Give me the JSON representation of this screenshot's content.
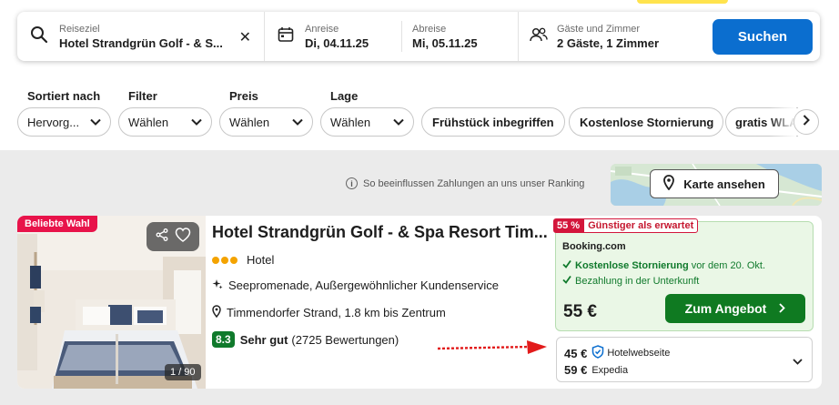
{
  "search": {
    "destination_label": "Reiseziel",
    "destination_value": "Hotel Strandgrün Golf - & S...",
    "checkin_label": "Anreise",
    "checkin_value": "Di, 04.11.25",
    "checkout_label": "Abreise",
    "checkout_value": "Mi, 05.11.25",
    "guests_label": "Gäste und Zimmer",
    "guests_value": "2 Gäste, 1 Zimmer",
    "button_label": "Suchen"
  },
  "filters": {
    "sort": {
      "label": "Sortiert nach",
      "value": "Hervorg..."
    },
    "filter": {
      "label": "Filter",
      "value": "Wählen"
    },
    "price": {
      "label": "Preis",
      "value": "Wählen"
    },
    "location": {
      "label": "Lage",
      "value": "Wählen"
    },
    "chips": [
      "Frühstück inbegriffen",
      "Kostenlose Stornierung",
      "gratis WLAN"
    ]
  },
  "ranking_note": "So beeinflussen Zahlungen an uns unser Ranking",
  "map_button": "Karte ansehen",
  "hotel": {
    "badge": "Beliebte Wahl",
    "photo_count": "1 / 90",
    "name": "Hotel Strandgrün Golf - & Spa Resort Tim...",
    "type": "Hotel",
    "star_count": 3,
    "features": "Seepromenade, Außergewöhnlicher Kundenservice",
    "location": "Timmendorfer Strand, 1.8 km bis Zentrum",
    "rating_score": "8.3",
    "rating_word": "Sehr gut",
    "rating_count": "(2725 Bewertungen)",
    "deal": {
      "discount": "55 %",
      "tag": "Günstiger als erwartet",
      "provider": "Booking.com",
      "cancel_bold": "Kostenlose Stornierung",
      "cancel_rest": "vor dem 20. Okt.",
      "payment": "Bezahlung in der Unterkunft",
      "price": "55 €",
      "button": "Zum Angebot"
    },
    "alternatives": [
      {
        "price": "45 €",
        "source": "Hotelwebseite"
      },
      {
        "price": "59 €",
        "source": "Expedia"
      }
    ]
  },
  "colors": {
    "primary_blue": "#0b6ecf",
    "deal_green": "#0f7a21",
    "rating_green": "#107a2c",
    "badge_red": "#e8134a",
    "stars_orange": "#f4a300"
  }
}
